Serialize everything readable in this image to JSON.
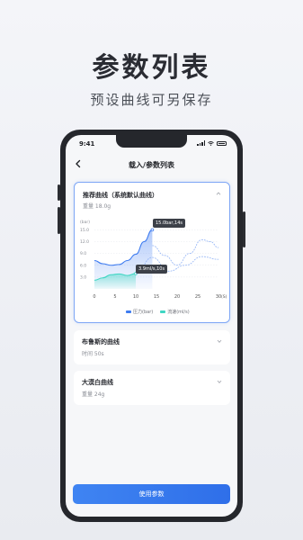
{
  "hero": {
    "title": "参数列表",
    "subtitle": "预设曲线可另保存"
  },
  "status_bar": {
    "time": "9:41"
  },
  "nav": {
    "title": "载入/参数列表"
  },
  "cards": [
    {
      "title": "推荐曲线（系统默认曲线）",
      "detail": "重量 18.0g",
      "expanded": true
    },
    {
      "title": "布鲁斯的曲线",
      "detail": "时间 50s",
      "expanded": false
    },
    {
      "title": "大漠白曲线",
      "detail": "重量 24g",
      "expanded": false
    }
  ],
  "chart_data": {
    "type": "line",
    "ylabel": "(bar)",
    "xlabel": "(S)",
    "x_ticks": [
      "0",
      "5",
      "10",
      "15",
      "20",
      "25",
      "30"
    ],
    "y_ticks": [
      "15.0",
      "12.0",
      "9.0",
      "6.0",
      "3.0"
    ],
    "xlim": [
      0,
      30
    ],
    "ylim": [
      0,
      16
    ],
    "series": [
      {
        "name": "压力(bar)",
        "color": "#3f7cf0",
        "x": [
          0,
          2,
          4,
          6,
          8,
          10,
          12,
          14
        ],
        "values": [
          7.2,
          6.4,
          6.0,
          6.2,
          7.2,
          8.8,
          12.0,
          15.0
        ]
      },
      {
        "name": "流速(ml/s)",
        "color": "#3fd6c3",
        "x": [
          0,
          2,
          4,
          6,
          8,
          10
        ],
        "values": [
          2.2,
          2.8,
          3.6,
          3.8,
          3.4,
          3.9
        ]
      },
      {
        "name": "",
        "color": "#8db0f5",
        "dashed": true,
        "x": [
          14,
          17,
          20,
          23,
          26,
          28,
          30
        ],
        "values": [
          11.0,
          8.5,
          6.0,
          9.0,
          12.5,
          12.0,
          10.5
        ]
      },
      {
        "name": "",
        "color": "#8db0f5",
        "dashed": true,
        "x": [
          10,
          14,
          18,
          22,
          26,
          30
        ],
        "values": [
          3.9,
          8.0,
          4.5,
          6.0,
          8.2,
          7.5
        ]
      }
    ],
    "annotations": [
      "15.0bar,14s",
      "3.9ml/s,10s"
    ],
    "legend": [
      "压力(bar)",
      "流速(ml/s)"
    ],
    "grid": true
  },
  "button": {
    "label": "使用参数"
  },
  "colors": {
    "accent": "#3f7cf0",
    "flow": "#3fd6c3",
    "active_border": "#7da6f5"
  }
}
